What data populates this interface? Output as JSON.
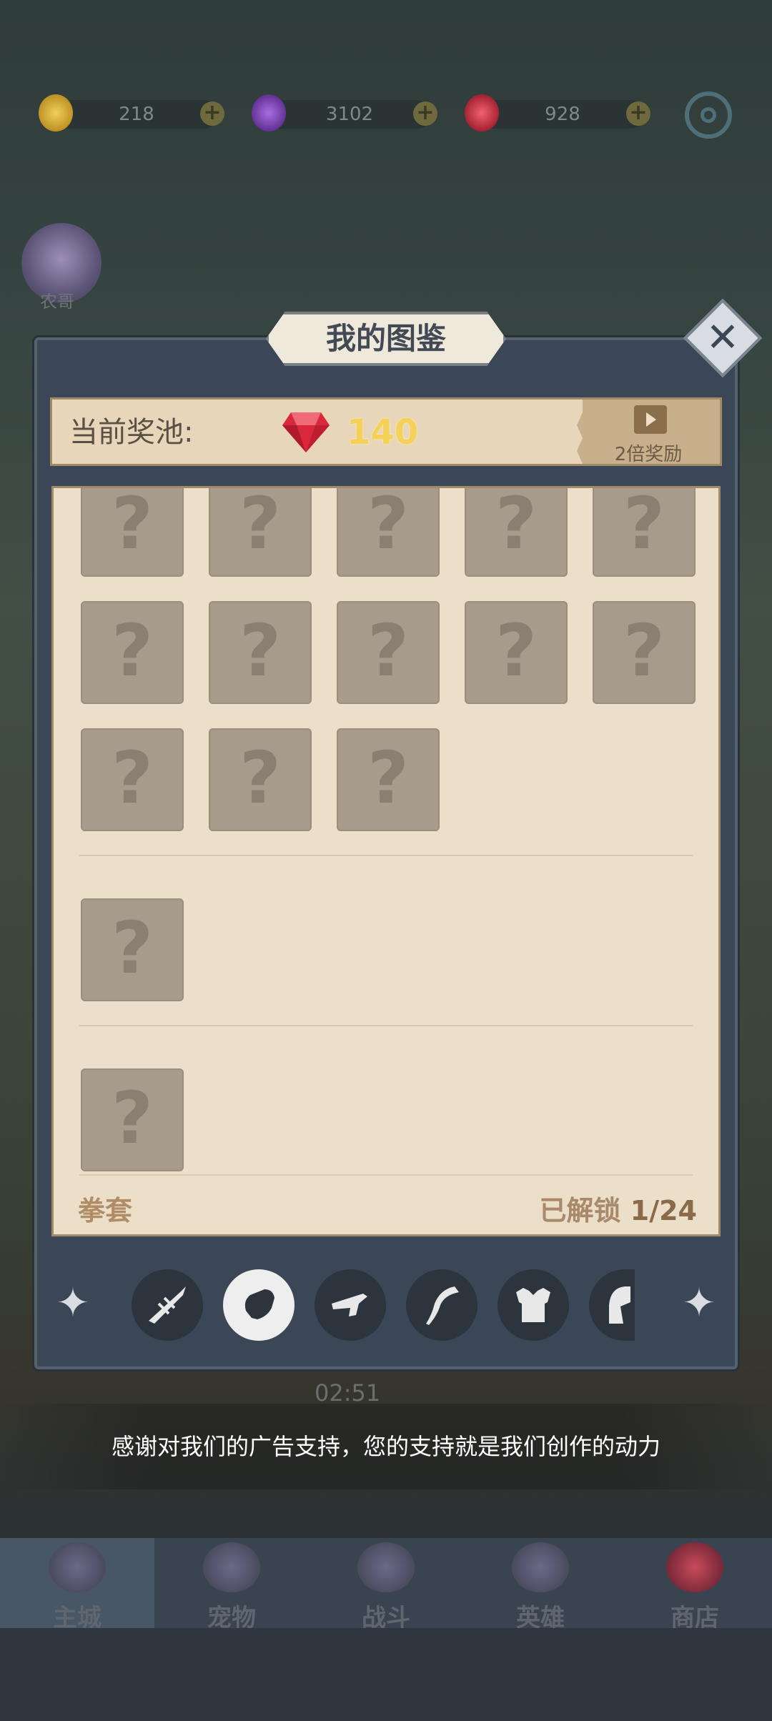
{
  "resources": [
    {
      "name": "gold",
      "value": "218",
      "color": "#d9b23a"
    },
    {
      "name": "purple-gem",
      "value": "3102",
      "color": "#7a3bb5"
    },
    {
      "name": "red-gem",
      "value": "928",
      "color": "#d02a3a"
    }
  ],
  "avatar": {
    "label": "农哥"
  },
  "dialog": {
    "title": "我的图鉴",
    "close_icon": "close-icon",
    "pool": {
      "label": "当前奖池:",
      "amount": "140",
      "ad_label": "2倍奖励"
    },
    "slot_mark": "?",
    "category_label": "拳套",
    "unlock": {
      "label": "已解锁",
      "count": "1/24"
    }
  },
  "tabs": [
    {
      "name": "spear-icon",
      "active": false
    },
    {
      "name": "gauntlet-icon",
      "active": true
    },
    {
      "name": "gun-icon",
      "active": false
    },
    {
      "name": "scythe-icon",
      "active": false
    },
    {
      "name": "armor-icon",
      "active": false
    },
    {
      "name": "helmet-icon",
      "active": false
    }
  ],
  "timer": "02:51",
  "ad_banner": "感谢对我们的广告支持，您的支持就是我们创作的动力",
  "nav": [
    {
      "label": "主城",
      "active": true
    },
    {
      "label": "宠物",
      "active": false
    },
    {
      "label": "战斗",
      "active": false
    },
    {
      "label": "英雄",
      "active": false
    },
    {
      "label": "商店",
      "active": false
    }
  ]
}
